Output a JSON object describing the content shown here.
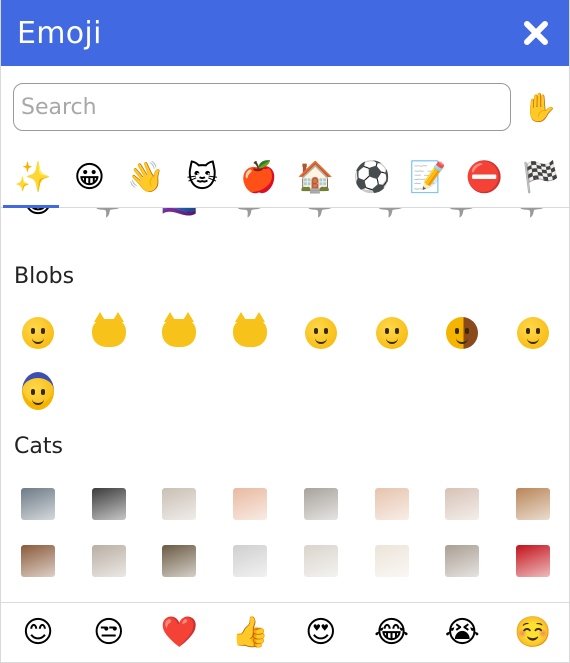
{
  "window": {
    "title": "Emoji",
    "close_icon": "close-icon"
  },
  "search": {
    "value": "",
    "placeholder": "Search",
    "skin_tone_glyph": "✋"
  },
  "categories": [
    {
      "name": "recent",
      "glyph": "✨",
      "active": true
    },
    {
      "name": "smileys",
      "glyph": "😀"
    },
    {
      "name": "people",
      "glyph": "👋"
    },
    {
      "name": "animals",
      "glyph": "🐱"
    },
    {
      "name": "food",
      "glyph": "🍎"
    },
    {
      "name": "travel",
      "glyph": "🏠"
    },
    {
      "name": "activities",
      "glyph": "⚽"
    },
    {
      "name": "objects",
      "glyph": "📝"
    },
    {
      "name": "symbols",
      "glyph": "⛔"
    },
    {
      "name": "flags",
      "glyph": "🏁"
    }
  ],
  "partial_row": [
    "😹",
    "🦈",
    "🏳️‍🌈",
    "🦈",
    "🦈",
    "🦈",
    "🦈",
    "🦈"
  ],
  "sections": [
    {
      "title": "Blobs",
      "rows": [
        [
          "blob-surprised",
          "blob-cat",
          "blob-cat-sneeze",
          "blob-cat-sleep",
          "blob-thinking",
          "blob-squint",
          "blob-peek-wall",
          "blob-hide"
        ],
        [
          "blob-wizard"
        ]
      ]
    },
    {
      "title": "Cats",
      "rows": [
        [
          "cat-photo-1",
          "cat-photo-2",
          "cat-photo-3",
          "cat-photo-4",
          "cat-photo-5",
          "cat-photo-6",
          "cat-photo-7",
          "cat-photo-8"
        ],
        [
          "cat-photo-9",
          "cat-photo-10",
          "cat-photo-11",
          "cat-photo-12",
          "cat-photo-13",
          "cat-photo-14",
          "cat-photo-15",
          "cat-photo-16"
        ]
      ]
    }
  ],
  "frequent": [
    "😊",
    "😒",
    "❤️",
    "👍",
    "😍",
    "😂",
    "😭",
    "☺️"
  ],
  "colors": {
    "accent": "#4169e1",
    "border": "#dadada"
  }
}
